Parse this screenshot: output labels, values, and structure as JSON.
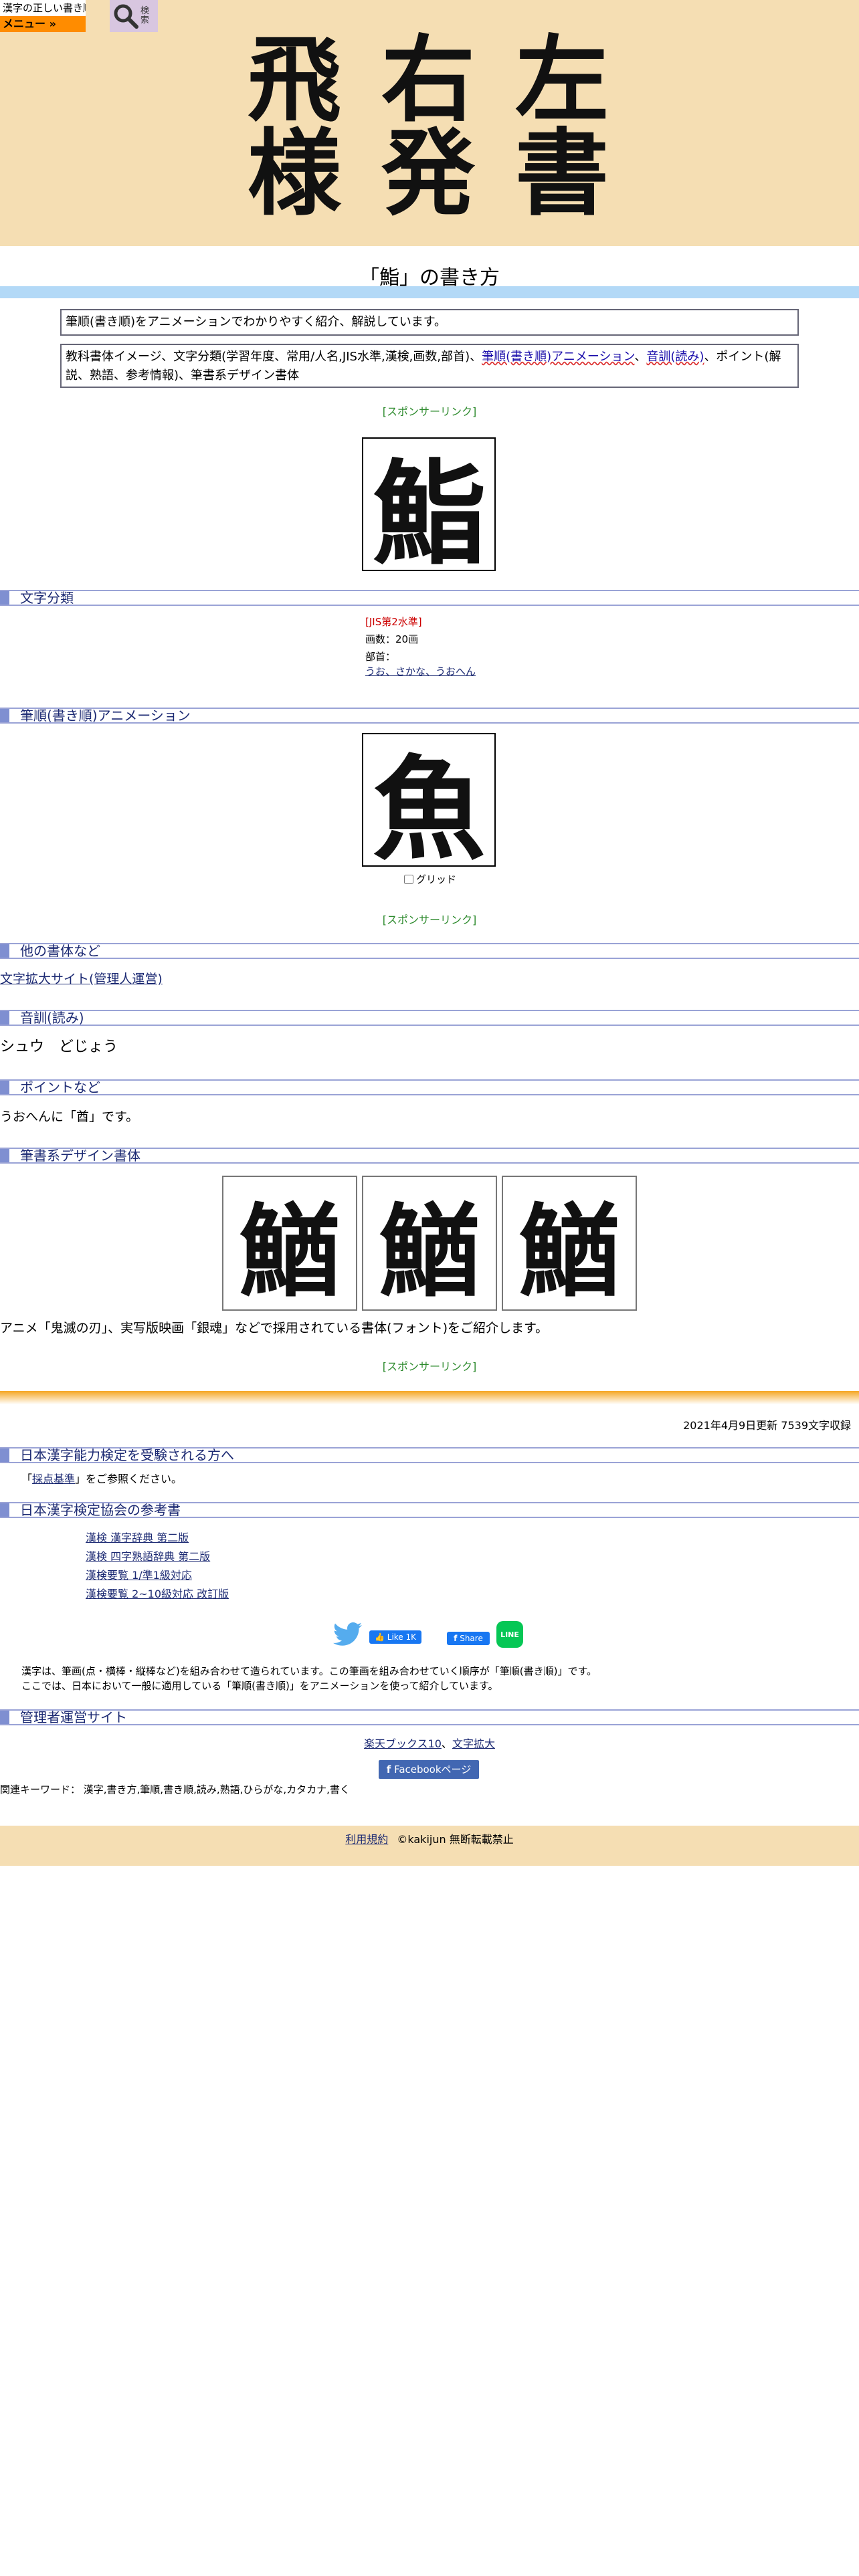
{
  "header": {
    "logo_text": "漢字の正しい書き順(筆順)",
    "menu_label": "メニュー »",
    "search_label": "検索",
    "hero_chars": [
      "飛",
      "右",
      "左",
      "様",
      "発",
      "書"
    ]
  },
  "page_title": "「鮨」の書き方",
  "intro": {
    "line1": "筆順(書き順)をアニメーションでわかりやすく紹介、解説しています。",
    "line2_prefix": "教科書体イメージ、文字分類(学習年度、常用/人名,JIS水準,漢検,画数,部首)、",
    "line2_link1": "筆順(書き順)アニメーション",
    "line2_sep": "、",
    "line2_link2": "音訓(読み)",
    "line2_suffix": "、ポイント(解説、熟語、参考情報)、筆書系デザイン書体"
  },
  "sponsor_label": "[スポンサーリンク]",
  "main_kanji": "鮨",
  "sections": {
    "classification": "文字分類",
    "stroke_anim": "筆順(書き順)アニメーション",
    "other_fonts": "他の書体など",
    "reading": "音訓(読み)",
    "points": "ポイントなど",
    "brush_design": "筆書系デザイン書体",
    "kanken_exam": "日本漢字能力検定を受験される方へ",
    "kanken_ref": "日本漢字検定協会の参考書",
    "admin_sites": "管理者運営サイト"
  },
  "classification": {
    "jis_level": "[JIS第2水準]",
    "stroke_count": "画数：20画",
    "radical_label": "部首：",
    "radical_value": "うお、さかな、うおへん"
  },
  "anim": {
    "current_char": "魚",
    "grid_label": "グリッド"
  },
  "other_fonts_link": "文字拡大サイト(管理人運営)",
  "reading_text": "シュウ　どじょう",
  "points_text": "うおへんに「酋」です。",
  "brush_chars": [
    "鰌",
    "鰌",
    "鰌"
  ],
  "brush_caption": "アニメ「鬼滅の刃」、実写版映画「銀魂」などで採用されている書体(フォント)をご紹介します。",
  "update_info": "2021年4月9日更新 7539文字収録",
  "kanken_note_prefix": "「",
  "kanken_note_link": "採点基準",
  "kanken_note_suffix": "」をご参照ください。",
  "kanken_books": [
    "漢検 漢字辞典 第二版",
    "漢検 四字熟語辞典 第二版",
    "漢検要覧 1/準1級対応",
    "漢検要覧 2~10級対応 改訂版"
  ],
  "social": {
    "like": "Like 1K",
    "share": "Share",
    "line": "LINE"
  },
  "explain1": "漢字は、筆画(点・横棒・縦棒など)を組み合わせて造られています。この筆画を組み合わせていく順序が「筆順(書き順)」です。",
  "explain2": "ここでは、日本において一般に適用している「筆順(書き順)」をアニメーションを使って紹介しています。",
  "admin_links": {
    "link1": "楽天ブックス10",
    "sep": "、",
    "link2": "文字拡大"
  },
  "fb_page_label": "Facebookページ",
  "keywords": "関連キーワード： 漢字,書き方,筆順,書き順,読み,熟語,ひらがな,カタカナ,書く",
  "footer": {
    "terms": "利用規約",
    "copyright": "©kakijun 無断転載禁止"
  }
}
